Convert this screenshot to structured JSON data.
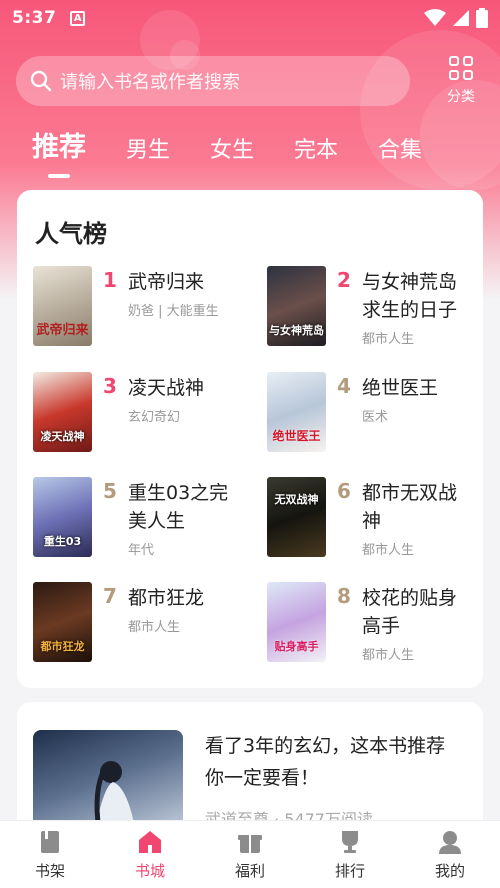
{
  "status": {
    "time": "5:37",
    "app_badge": "A"
  },
  "search": {
    "placeholder": "请输入书名或作者搜索",
    "category_label": "分类"
  },
  "tabs": [
    "推荐",
    "男生",
    "女生",
    "完本",
    "合集"
  ],
  "ranking": {
    "title": "人气榜",
    "books": [
      {
        "rank": "1",
        "title_line1": "武帝归来",
        "title_line2": "",
        "sub": "奶爸 | 大能重生",
        "cover_text": "武帝归来"
      },
      {
        "rank": "2",
        "title_line1": "与女神荒岛",
        "title_line2": "求生的日子",
        "sub": "都市人生",
        "cover_text": "与女神荒岛"
      },
      {
        "rank": "3",
        "title_line1": "凌天战神",
        "title_line2": "",
        "sub": "玄幻奇幻",
        "cover_text": "凌天战神"
      },
      {
        "rank": "4",
        "title_line1": "绝世医王",
        "title_line2": "",
        "sub": "医术",
        "cover_text": "绝世医王"
      },
      {
        "rank": "5",
        "title_line1": "重生03之完",
        "title_line2": "美人生",
        "sub": "年代",
        "cover_text": "重生03"
      },
      {
        "rank": "6",
        "title_line1": "都市无双战",
        "title_line2": "神",
        "sub": "都市人生",
        "cover_text": "无双战神"
      },
      {
        "rank": "7",
        "title_line1": "都市狂龙",
        "title_line2": "",
        "sub": "都市人生",
        "cover_text": "都市狂龙"
      },
      {
        "rank": "8",
        "title_line1": "校花的贴身",
        "title_line2": "高手",
        "sub": "都市人生",
        "cover_text": "贴身高手"
      }
    ]
  },
  "recommend": {
    "text_line1": "看了3年的玄幻，这本书推荐",
    "text_line2": "你一定要看！",
    "meta": "武道至尊 · 5477万阅读"
  },
  "nav": [
    "书架",
    "书城",
    "福利",
    "排行",
    "我的"
  ],
  "colors": {
    "accent": "#f0466f",
    "rank_top": "#f0466f",
    "rank_other": "#b39b7d"
  }
}
